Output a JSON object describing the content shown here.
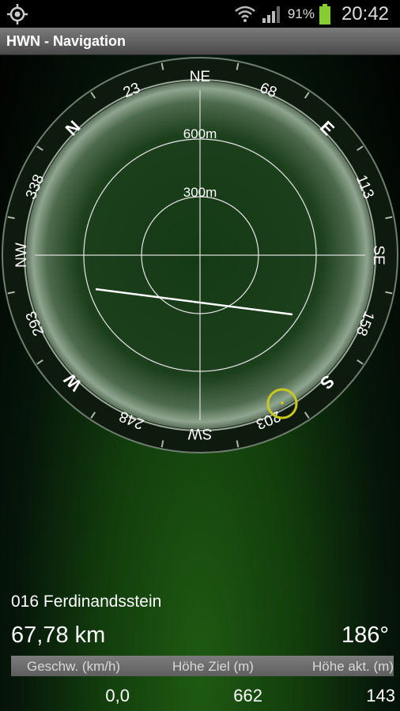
{
  "status_bar": {
    "battery_percent": "91%",
    "time": "20:42",
    "icons": [
      "gps-icon",
      "wifi-icon",
      "signal-icon",
      "battery-icon"
    ]
  },
  "app_title": "HWN - Navigation",
  "compass": {
    "ring_labels": {
      "N": "N",
      "NE": "NE",
      "E": "E",
      "SE": "SE",
      "S": "S",
      "SW": "SW",
      "W": "W",
      "NW": "NW",
      "d23": "23",
      "d68": "68",
      "d113": "113",
      "d158": "158",
      "d203": "203",
      "d248": "248",
      "d293": "293",
      "d338": "338"
    },
    "range_labels": {
      "outer": "600m",
      "inner": "300m"
    }
  },
  "destination": {
    "name": "016 Ferdinandsstein",
    "distance": "67,78 km",
    "bearing": "186°"
  },
  "info": {
    "headers": [
      "Geschw. (km/h)",
      "Höhe Ziel (m)",
      "Höhe akt. (m)"
    ],
    "values": [
      "0,0",
      "662",
      "143"
    ]
  },
  "colors": {
    "accent_yellow": "#c8c820",
    "ring_dark": "#1d2a1d",
    "title_bar": "#5a5a5a"
  }
}
